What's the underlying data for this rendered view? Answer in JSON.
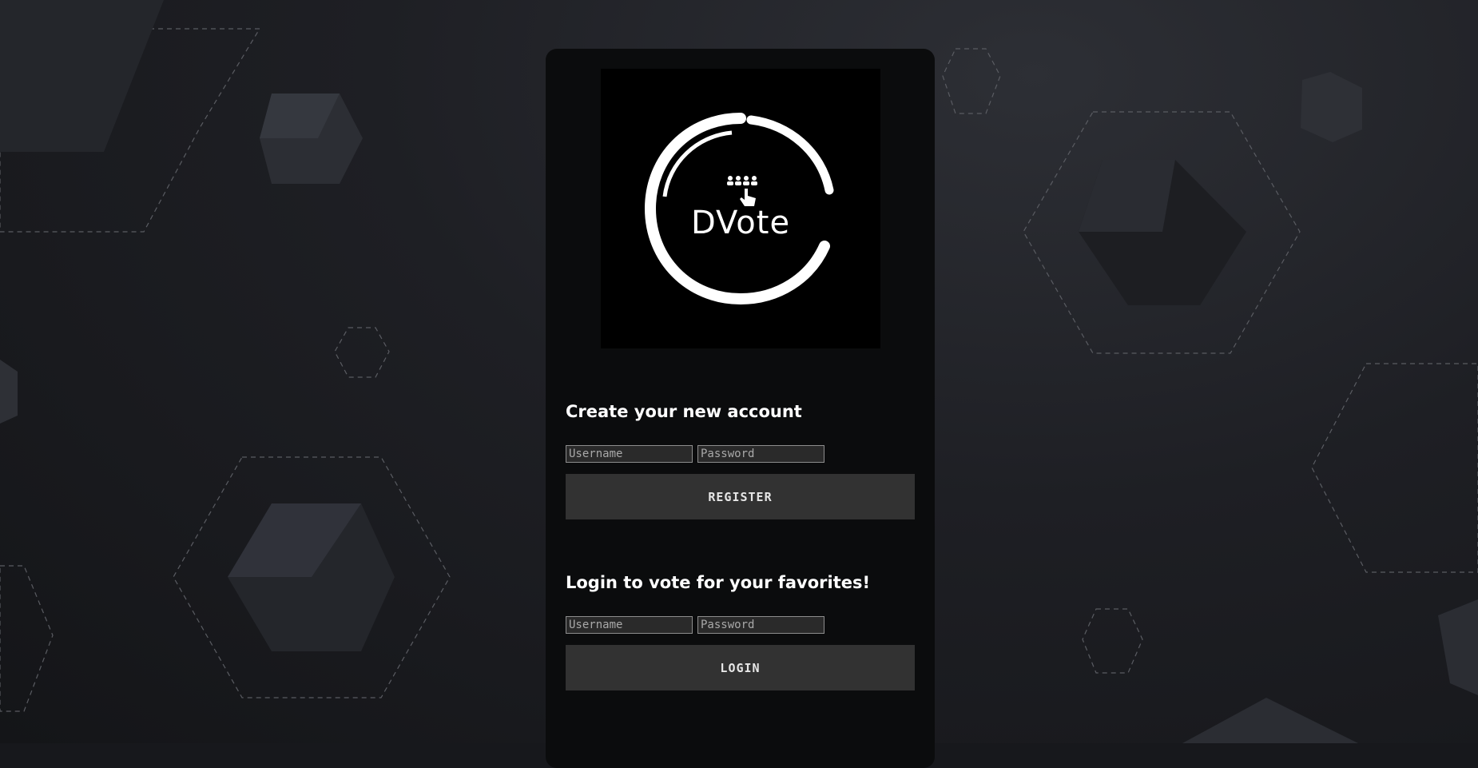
{
  "brand": {
    "logo_text": "DVote"
  },
  "register": {
    "title": "Create your new account",
    "username_placeholder": "Username",
    "password_placeholder": "Password",
    "button_label": "REGISTER"
  },
  "login": {
    "title": "Login to vote for your favorites!",
    "username_placeholder": "Username",
    "password_placeholder": "Password",
    "button_label": "LOGIN"
  },
  "colors": {
    "background": "#17181c",
    "card": "#0b0c0d",
    "button": "#323232",
    "text": "#ffffff"
  }
}
